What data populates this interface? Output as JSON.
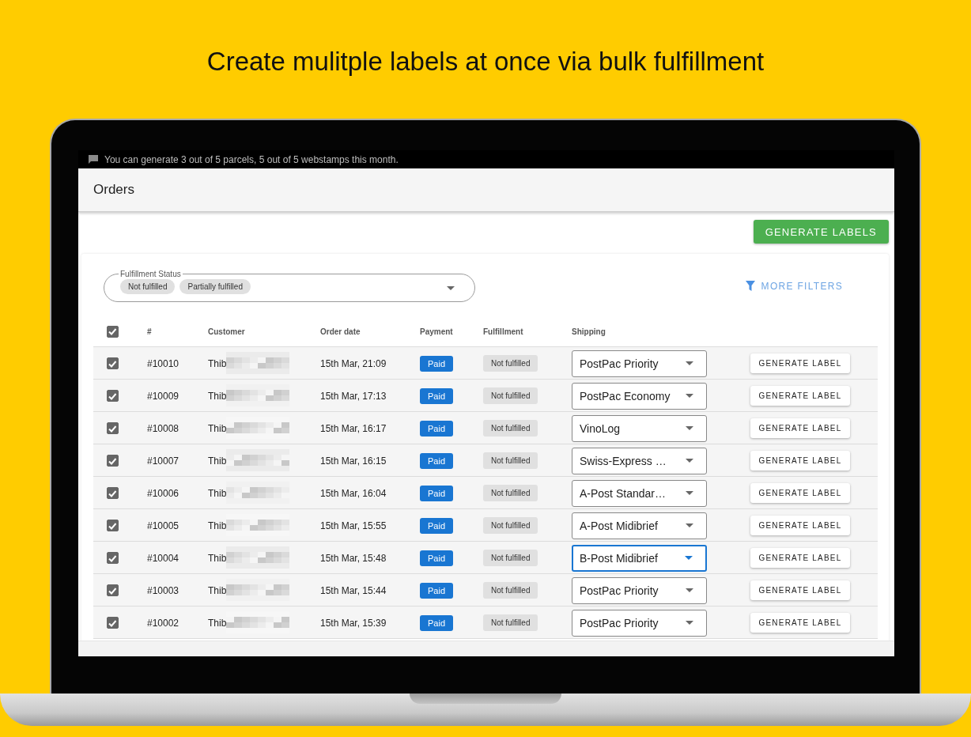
{
  "headline": "Create mulitple labels at once via bulk fulfillment",
  "notice": "You can generate 3 out of 5 parcels, 5 out of 5 webstamps this month.",
  "page_title": "Orders",
  "primary_button": "GENERATE LABELS",
  "filter": {
    "label": "Fulfillment Status",
    "chips": [
      "Not fulfilled",
      "Partially fulfilled"
    ]
  },
  "more_filters": "MORE FILTERS",
  "table": {
    "all_checked": true,
    "columns": [
      "#",
      "Customer",
      "Order date",
      "Payment",
      "Fulfillment",
      "Shipping"
    ],
    "rows": [
      {
        "checked": true,
        "number": "#10010",
        "customer": "Thib",
        "date": "15th Mar, 21:09",
        "payment": "Paid",
        "fulfillment": "Not fulfilled",
        "shipping": "PostPac Priority",
        "focused": false,
        "action": "GENERATE LABEL"
      },
      {
        "checked": true,
        "number": "#10009",
        "customer": "Thib",
        "date": "15th Mar, 17:13",
        "payment": "Paid",
        "fulfillment": "Not fulfilled",
        "shipping": "PostPac Economy",
        "focused": false,
        "action": "GENERATE LABEL"
      },
      {
        "checked": true,
        "number": "#10008",
        "customer": "Thib",
        "date": "15th Mar, 16:17",
        "payment": "Paid",
        "fulfillment": "Not fulfilled",
        "shipping": "VinoLog",
        "focused": false,
        "action": "GENERATE LABEL"
      },
      {
        "checked": true,
        "number": "#10007",
        "customer": "Thib",
        "date": "15th Mar, 16:15",
        "payment": "Paid",
        "fulfillment": "Not fulfilled",
        "shipping": "Swiss-Express …",
        "focused": false,
        "action": "GENERATE LABEL"
      },
      {
        "checked": true,
        "number": "#10006",
        "customer": "Thib",
        "date": "15th Mar, 16:04",
        "payment": "Paid",
        "fulfillment": "Not fulfilled",
        "shipping": "A-Post Standar…",
        "focused": false,
        "action": "GENERATE LABEL"
      },
      {
        "checked": true,
        "number": "#10005",
        "customer": "Thib",
        "date": "15th Mar, 15:55",
        "payment": "Paid",
        "fulfillment": "Not fulfilled",
        "shipping": "A-Post Midibrief",
        "focused": false,
        "action": "GENERATE LABEL"
      },
      {
        "checked": true,
        "number": "#10004",
        "customer": "Thib",
        "date": "15th Mar, 15:48",
        "payment": "Paid",
        "fulfillment": "Not fulfilled",
        "shipping": "B-Post Midibrief",
        "focused": true,
        "action": "GENERATE LABEL"
      },
      {
        "checked": true,
        "number": "#10003",
        "customer": "Thib",
        "date": "15th Mar, 15:44",
        "payment": "Paid",
        "fulfillment": "Not fulfilled",
        "shipping": "PostPac Priority",
        "focused": false,
        "action": "GENERATE LABEL"
      },
      {
        "checked": true,
        "number": "#10002",
        "customer": "Thib",
        "date": "15th Mar, 15:39",
        "payment": "Paid",
        "fulfillment": "Not fulfilled",
        "shipping": "PostPac Priority",
        "focused": false,
        "action": "GENERATE LABEL"
      }
    ]
  }
}
